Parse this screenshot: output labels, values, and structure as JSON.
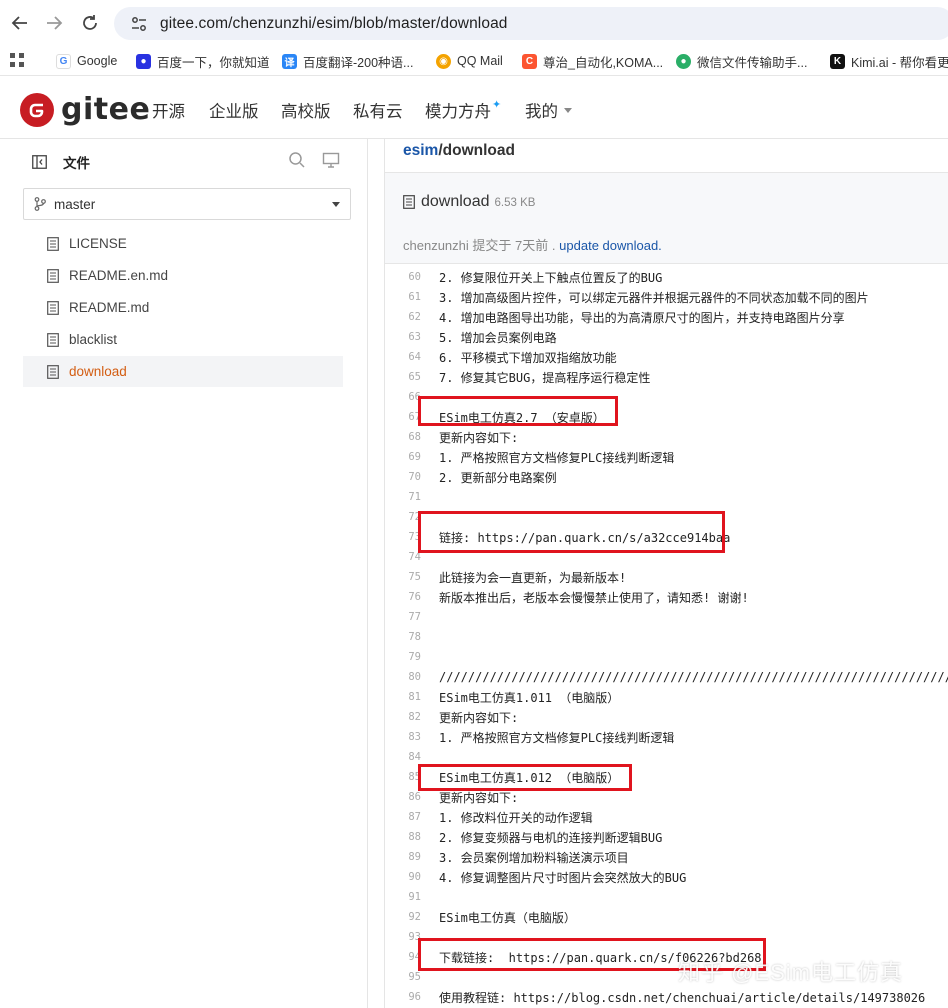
{
  "browser": {
    "url": "gitee.com/chenzunzhi/esim/blob/master/download",
    "bookmarks": [
      {
        "label": "Google",
        "icon": "google-icon",
        "color": "#4285f4"
      },
      {
        "label": "百度一下，你就知道",
        "icon": "baidu-icon",
        "color": "#2932e1"
      },
      {
        "label": "百度翻译-200种语...",
        "icon": "translate-icon",
        "color": "#2a86f6"
      },
      {
        "label": "QQ Mail",
        "icon": "qqmail-icon",
        "color": "#f4a300"
      },
      {
        "label": "尊治_自动化,KOMA...",
        "icon": "csdn-icon",
        "color": "#fc5531"
      },
      {
        "label": "微信文件传输助手...",
        "icon": "wechat-icon",
        "color": "#2aae67"
      },
      {
        "label": "Kimi.ai - 帮你看更",
        "icon": "kimi-icon",
        "color": "#111111"
      }
    ]
  },
  "header": {
    "logo_text": "gitee",
    "nav": [
      "开源",
      "企业版",
      "高校版",
      "私有云",
      "模力方舟",
      "我的"
    ]
  },
  "sidebar": {
    "title": "文件",
    "branch": "master",
    "files": [
      "LICENSE",
      "README.en.md",
      "README.md",
      "blacklist",
      "download"
    ],
    "active_file": "download"
  },
  "main": {
    "breadcrumb_repo": "esim",
    "breadcrumb_sep": "/",
    "breadcrumb_file": "download",
    "file_name": "download",
    "file_size": "6.53 KB",
    "commit_author": "chenzunzhi",
    "commit_action": "提交于",
    "commit_time": "7天前",
    "commit_sep": ".",
    "commit_message": "update download."
  },
  "code_lines": [
    {
      "n": "60",
      "t": "2. 修复限位开关上下触点位置反了的BUG"
    },
    {
      "n": "61",
      "t": "3. 增加高级图片控件，可以绑定元器件并根据元器件的不同状态加载不同的图片"
    },
    {
      "n": "62",
      "t": "4. 增加电路图导出功能，导出的为高清原尺寸的图片，并支持电路图片分享"
    },
    {
      "n": "63",
      "t": "5. 增加会员案例电路"
    },
    {
      "n": "64",
      "t": "6. 平移模式下增加双指缩放功能"
    },
    {
      "n": "65",
      "t": "7. 修复其它BUG，提高程序运行稳定性"
    },
    {
      "n": "66",
      "t": ""
    },
    {
      "n": "67",
      "t": "ESim电工仿真2.7 （安卓版）"
    },
    {
      "n": "68",
      "t": "更新内容如下:"
    },
    {
      "n": "69",
      "t": "1. 严格按照官方文档修复PLC接线判断逻辑"
    },
    {
      "n": "70",
      "t": "2. 更新部分电路案例"
    },
    {
      "n": "71",
      "t": ""
    },
    {
      "n": "72",
      "t": ""
    },
    {
      "n": "73",
      "t": "链接: https://pan.quark.cn/s/a32cce914baa"
    },
    {
      "n": "74",
      "t": ""
    },
    {
      "n": "75",
      "t": "此链接为会一直更新，为最新版本!"
    },
    {
      "n": "76",
      "t": "新版本推出后，老版本会慢慢禁止使用了，请知悉! 谢谢!"
    },
    {
      "n": "77",
      "t": ""
    },
    {
      "n": "78",
      "t": ""
    },
    {
      "n": "79",
      "t": ""
    },
    {
      "n": "80",
      "t": "////////////////////////////////////////////////////////////////////////////////"
    },
    {
      "n": "81",
      "t": "ESim电工仿真1.011 （电脑版）"
    },
    {
      "n": "82",
      "t": "更新内容如下:"
    },
    {
      "n": "83",
      "t": "1. 严格按照官方文档修复PLC接线判断逻辑"
    },
    {
      "n": "84",
      "t": ""
    },
    {
      "n": "85",
      "t": "ESim电工仿真1.012 （电脑版）"
    },
    {
      "n": "86",
      "t": "更新内容如下:"
    },
    {
      "n": "87",
      "t": "1. 修改料位开关的动作逻辑"
    },
    {
      "n": "88",
      "t": "2. 修复变频器与电机的连接判断逻辑BUG"
    },
    {
      "n": "89",
      "t": "3. 会员案例增加粉料输送演示项目"
    },
    {
      "n": "90",
      "t": "4. 修复调整图片尺寸时图片会突然放大的BUG"
    },
    {
      "n": "91",
      "t": ""
    },
    {
      "n": "92",
      "t": "ESim电工仿真（电脑版）"
    },
    {
      "n": "93",
      "t": ""
    },
    {
      "n": "94",
      "t": "下载链接:  https://pan.quark.cn/s/f06226?bd268"
    },
    {
      "n": "95",
      "t": ""
    },
    {
      "n": "96",
      "t": "使用教程链: https://blog.csdn.net/chenchuai/article/details/149738026"
    }
  ],
  "watermark": "知乎 @ESim电工仿真",
  "colors": {
    "accent": "#c71d23",
    "link": "#1a56a8",
    "active_file": "#d35d12",
    "highlight_box": "#e0141e"
  }
}
